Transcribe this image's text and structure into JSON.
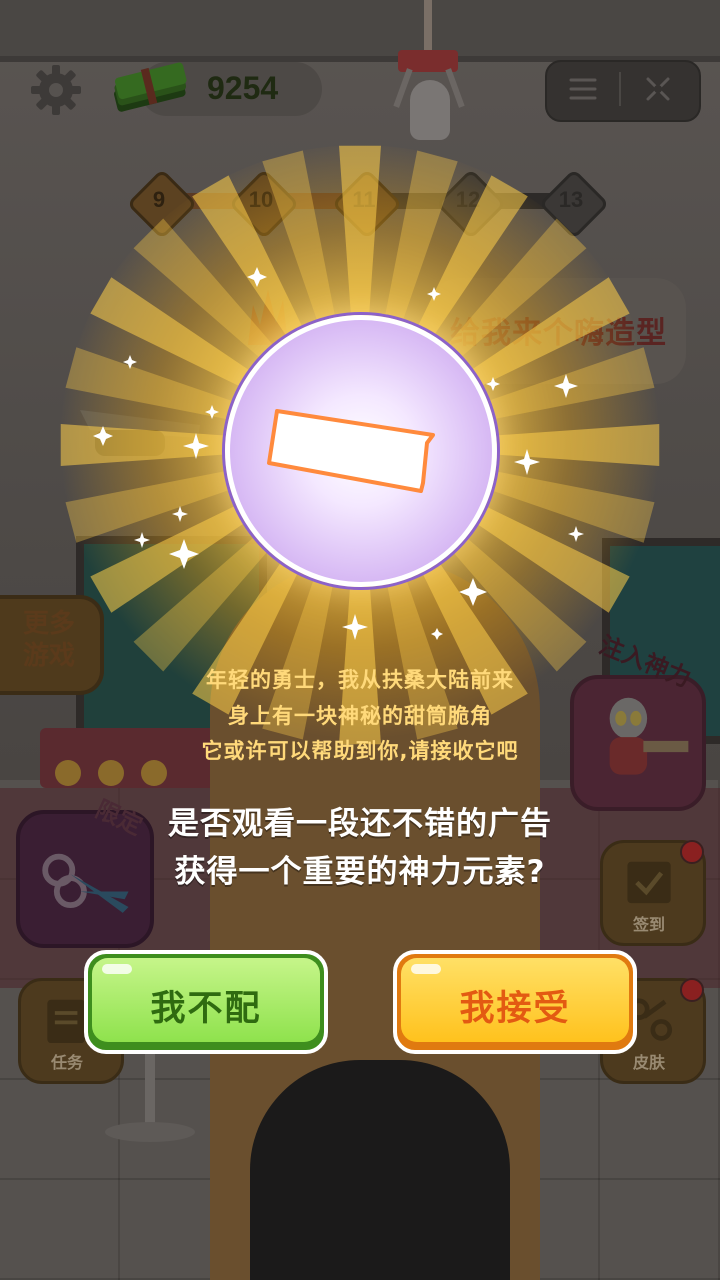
{
  "hud": {
    "money": "9254",
    "money_icon": "cash-stack-icon",
    "settings_icon": "gear-icon",
    "menu_icon": "hamburger-icon",
    "close_icon": "close-icon"
  },
  "levels": [
    "9",
    "10",
    "11",
    "12",
    "13"
  ],
  "scene": {
    "speech_bubble": "给我来个嗨造型"
  },
  "side_buttons": {
    "more_games": "更多游戏",
    "inject_power": "注入神力",
    "limited": "限定",
    "signin": "签到",
    "task": "任务",
    "skin": "皮肤"
  },
  "popup": {
    "reward_item": "waffle-cone-piece-icon",
    "story_lines": [
      "年轻的勇士，我从扶桑大陆前来",
      "身上有一块神秘的甜筒脆角",
      "它或许可以帮助到你,请接收它吧"
    ],
    "question_lines": [
      "是否观看一段还不错的广告",
      "获得一个重要的神力元素?"
    ],
    "reject_label": "我不配",
    "accept_label": "我接受"
  },
  "colors": {
    "reject_button": "#8fe24d",
    "accept_button": "#ffc21d",
    "story_text": "#ffd97a"
  }
}
